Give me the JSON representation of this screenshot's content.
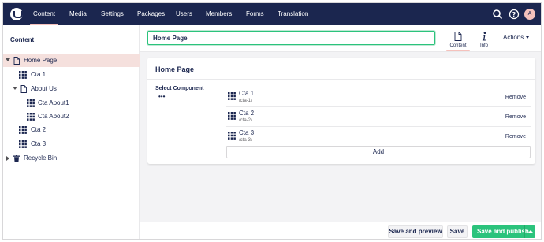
{
  "topbar": {
    "sections": [
      "Content",
      "Media",
      "Settings",
      "Packages",
      "Users",
      "Members",
      "Forms",
      "Translation"
    ],
    "active_section": "Content",
    "avatar_initial": "A"
  },
  "tree": {
    "title": "Content",
    "items": [
      {
        "label": "Home Page",
        "icon": "document-icon"
      },
      {
        "label": "Cta 1",
        "icon": "grid-icon"
      },
      {
        "label": "About Us",
        "icon": "document-icon"
      },
      {
        "label": "Cta About1",
        "icon": "grid-icon"
      },
      {
        "label": "Cta About2",
        "icon": "grid-icon"
      },
      {
        "label": "Cta 2",
        "icon": "grid-icon"
      },
      {
        "label": "Cta 3",
        "icon": "grid-icon"
      },
      {
        "label": "Recycle Bin",
        "icon": "trash-icon"
      }
    ]
  },
  "editor": {
    "name_value": "Home Page",
    "apps": [
      {
        "label": "Content",
        "icon": "document-icon"
      },
      {
        "label": "Info",
        "icon": "info-icon"
      }
    ],
    "actions_label": "Actions"
  },
  "panel": {
    "title": "Home Page",
    "property_label": "Select Component",
    "property_menu": "•••",
    "nodes": [
      {
        "name": "Cta 1",
        "path": "/cta-1/",
        "remove": "Remove"
      },
      {
        "name": "Cta 2",
        "path": "/cta-2/",
        "remove": "Remove"
      },
      {
        "name": "Cta 3",
        "path": "/cta-3/",
        "remove": "Remove"
      }
    ],
    "add_label": "Add"
  },
  "footer": {
    "save_preview": "Save and preview",
    "save": "Save",
    "save_publish": "Save and publish"
  },
  "colors": {
    "header": "#1b264f",
    "accent": "#f5c1bc",
    "success": "#2bc37c",
    "selected_row": "#f5e0dd"
  }
}
